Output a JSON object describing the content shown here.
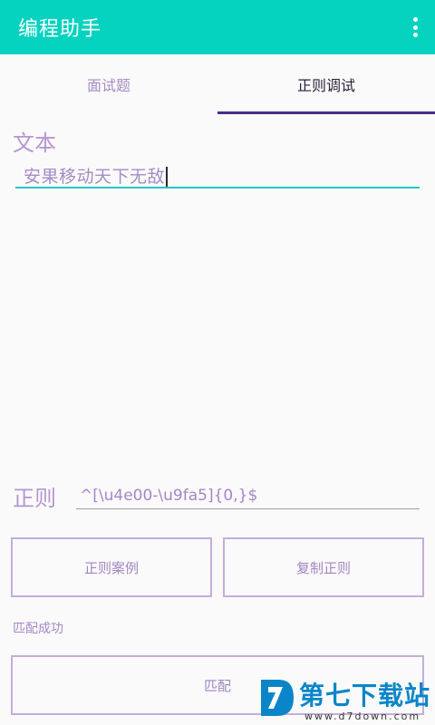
{
  "appbar": {
    "title": "编程助手",
    "menu_icon": "more-vert-icon"
  },
  "tabs": [
    {
      "label": "面试题",
      "selected": false
    },
    {
      "label": "正则调试",
      "selected": true
    }
  ],
  "text_field": {
    "label": "文本",
    "value": "安果移动天下无敌"
  },
  "regex_field": {
    "label": "正则",
    "value": "^[\\u4e00-\\u9fa5]{0,}$"
  },
  "buttons": {
    "examples": "正则案例",
    "copy": "复制正则",
    "match": "匹配"
  },
  "status": "匹配成功",
  "watermark": {
    "brand": "第七下载站",
    "url": "www.d7down.com"
  },
  "colors": {
    "appbar": "#06d3bf",
    "tab_indicator": "#4a2b8a",
    "accent_underline": "#23c6c3",
    "text_purple": "#a58cc4"
  }
}
